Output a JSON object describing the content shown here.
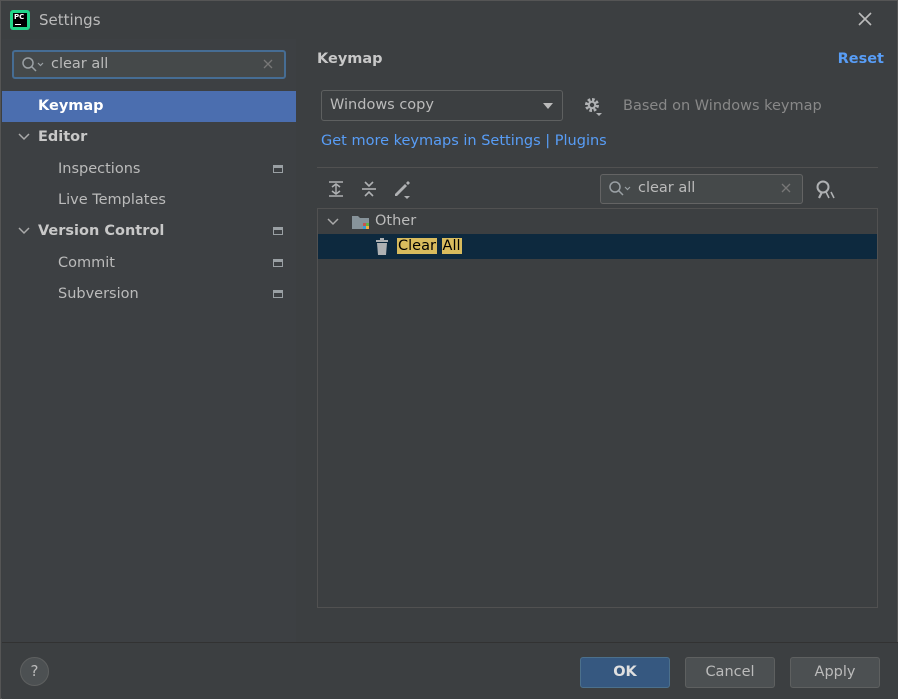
{
  "window": {
    "title": "Settings"
  },
  "sidebar": {
    "search_value": "clear all",
    "items": [
      {
        "label": "Keymap",
        "selected": true,
        "bold": true,
        "level": 0
      },
      {
        "label": "Editor",
        "expanded": true,
        "bold": true,
        "level": 0
      },
      {
        "label": "Inspections",
        "level": 1,
        "project_icon": true
      },
      {
        "label": "Live Templates",
        "level": 1
      },
      {
        "label": "Version Control",
        "expanded": true,
        "bold": true,
        "level": 0,
        "project_icon": true
      },
      {
        "label": "Commit",
        "level": 1,
        "project_icon": true
      },
      {
        "label": "Subversion",
        "level": 1,
        "project_icon": true
      }
    ]
  },
  "main": {
    "title": "Keymap",
    "reset_label": "Reset",
    "keymap_selected": "Windows copy",
    "based_on": "Based on Windows keymap",
    "get_more_link": "Get more keymaps in Settings | Plugins",
    "filter_value": "clear all",
    "toolbar_icons": [
      "expand-all-icon",
      "collapse-all-icon",
      "edit-icon",
      "search-icon",
      "find-shortcut-icon"
    ],
    "tree": {
      "group_label": "Other",
      "action_word1": "Clear",
      "action_word2": "All"
    }
  },
  "footer": {
    "help_label": "?",
    "ok_label": "OK",
    "cancel_label": "Cancel",
    "apply_label": "Apply"
  },
  "colors": {
    "selection": "#4b6eaf",
    "link": "#589df6",
    "highlight": "#d8bb5d",
    "ok_button": "#365880"
  }
}
